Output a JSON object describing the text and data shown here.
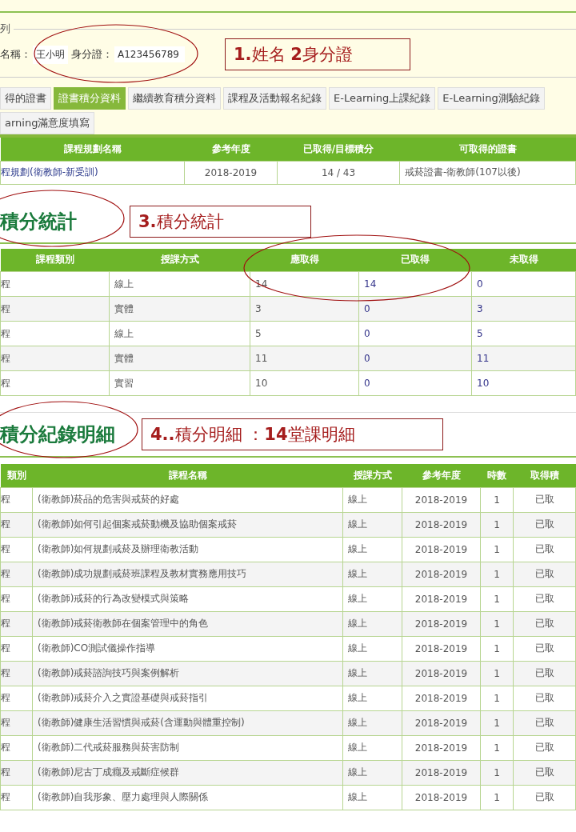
{
  "query": {
    "legend": "列",
    "name_label": "名稱：",
    "name_value": "王小明",
    "id_label": "身分證：",
    "id_value": "A123456789",
    "annotation": "**1.**姓名  **2**身分證"
  },
  "tabs": [
    {
      "label": "得的證書",
      "selected": false
    },
    {
      "label": "證書積分資料",
      "selected": true
    },
    {
      "label": "繼續教育積分資料",
      "selected": false
    },
    {
      "label": "課程及活動報名紀錄",
      "selected": false
    },
    {
      "label": "E-Learning上課紀錄",
      "selected": false
    },
    {
      "label": "E-Learning測驗紀錄",
      "selected": false
    },
    {
      "label": "arning滿意度填寫",
      "selected": false
    }
  ],
  "summary_table": {
    "columns": [
      "課程規劃名稱",
      "參考年度",
      "已取得/目標積分",
      "可取得的證書"
    ],
    "rows": [
      [
        "程規劃(衛教師-新受訓)",
        "2018-2019",
        "14 / 43",
        "戒菸證書-衛教師(107以後)"
      ]
    ]
  },
  "stats_section": {
    "title": "積分統計",
    "annotation": "**3.**積分統計"
  },
  "stats_table": {
    "columns": [
      "課程類別",
      "授課方式",
      "應取得",
      "已取得",
      "未取得"
    ],
    "rows": [
      [
        "程",
        "線上",
        "14",
        "14",
        "0"
      ],
      [
        "程",
        "實體",
        "3",
        "0",
        "3"
      ],
      [
        "程",
        "線上",
        "5",
        "0",
        "5"
      ],
      [
        "程",
        "實體",
        "11",
        "0",
        "11"
      ],
      [
        "程",
        "實習",
        "10",
        "0",
        "10"
      ]
    ]
  },
  "detail_section": {
    "title": "積分紀錄明細",
    "annotation": "**4..**積分明細 ：**14**堂課明細"
  },
  "detail_table": {
    "columns": [
      "類別",
      "課程名稱",
      "授課方式",
      "參考年度",
      "時數",
      "取得積"
    ],
    "rows": [
      [
        "程",
        "(衛教師)菸品的危害與戒菸的好處",
        "線上",
        "2018-2019",
        "1",
        "已取"
      ],
      [
        "程",
        "(衛教師)如何引起個案戒菸動機及協助個案戒菸",
        "線上",
        "2018-2019",
        "1",
        "已取"
      ],
      [
        "程",
        "(衛教師)如何規劃戒菸及辦理衛教活動",
        "線上",
        "2018-2019",
        "1",
        "已取"
      ],
      [
        "程",
        "(衛教師)成功規劃戒菸班課程及教材實務應用技巧",
        "線上",
        "2018-2019",
        "1",
        "已取"
      ],
      [
        "程",
        "(衛教師)戒菸的行為改變模式與策略",
        "線上",
        "2018-2019",
        "1",
        "已取"
      ],
      [
        "程",
        "(衛教師)戒菸衛教師在個案管理中的角色",
        "線上",
        "2018-2019",
        "1",
        "已取"
      ],
      [
        "程",
        "(衛教師)CO測試儀操作指導",
        "線上",
        "2018-2019",
        "1",
        "已取"
      ],
      [
        "程",
        "(衛教師)戒菸諮詢技巧與案例解析",
        "線上",
        "2018-2019",
        "1",
        "已取"
      ],
      [
        "程",
        "(衛教師)戒菸介入之實證基礎與戒菸指引",
        "線上",
        "2018-2019",
        "1",
        "已取"
      ],
      [
        "程",
        "(衛教師)健康生活習慣與戒菸(含運動與體重控制)",
        "線上",
        "2018-2019",
        "1",
        "已取"
      ],
      [
        "程",
        "(衛教師)二代戒菸服務與菸害防制",
        "線上",
        "2018-2019",
        "1",
        "已取"
      ],
      [
        "程",
        "(衛教師)尼古丁成癮及戒斷症候群",
        "線上",
        "2018-2019",
        "1",
        "已取"
      ],
      [
        "程",
        "(衛教師)自我形象、壓力處理與人際關係",
        "線上",
        "2018-2019",
        "1",
        "已取"
      ]
    ]
  }
}
